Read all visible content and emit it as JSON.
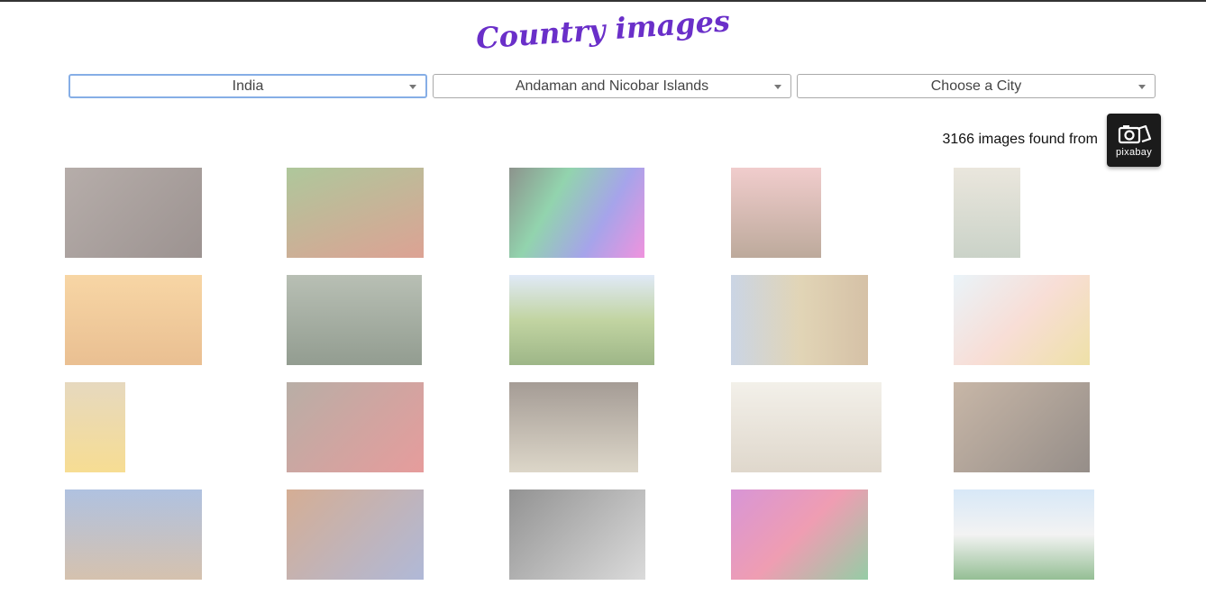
{
  "header": {
    "title": "Country images"
  },
  "filters": {
    "country": "India",
    "region": "Andaman and Nicobar Islands",
    "city": "Choose a City"
  },
  "results": {
    "count_text": "3166 images found from",
    "source_label": "pixabay"
  },
  "gallery": [
    {
      "name": "henna-hands",
      "bg": "linear-gradient(135deg,#7a6a64,#4b3a36)"
    },
    {
      "name": "tea-picker-woman",
      "bg": "linear-gradient(160deg,#6c9a4a,#c0563c)"
    },
    {
      "name": "color-powder-cones",
      "bg": "linear-gradient(120deg,#2f3b2f,#39b06b,#5d59d9,#e33bc2)"
    },
    {
      "name": "old-man-turban",
      "bg": "linear-gradient(180deg,#e5a3a3,#86644a)"
    },
    {
      "name": "taj-mahal-reflection",
      "bg": "linear-gradient(180deg,#d9d2c1,#9fae9b)"
    },
    {
      "name": "river-sunset-boats",
      "bg": "linear-gradient(180deg,#f1b45b,#d88b38)"
    },
    {
      "name": "elephant-forest",
      "bg": "linear-gradient(180deg,#7e8b77,#3a4c36)"
    },
    {
      "name": "green-hills",
      "bg": "linear-gradient(180deg,#c7d8f1,#8fb155,#4e7b26)"
    },
    {
      "name": "weathered-wall",
      "bg": "linear-gradient(90deg,#9fb2cf,#c9b27a,#b38e5e)"
    },
    {
      "name": "girl-painted-hands",
      "bg": "linear-gradient(135deg,#d8eaf4,#f2c2b4,#e0c85f)"
    },
    {
      "name": "woman-yellow-sari",
      "bg": "linear-gradient(180deg,#d2b98a,#f0c13a)"
    },
    {
      "name": "two-children",
      "bg": "linear-gradient(135deg,#7e6c5d,#d24b4b)"
    },
    {
      "name": "dancer-archway",
      "bg": "linear-gradient(180deg,#5b4b3f,#c0b59c)"
    },
    {
      "name": "misty-taj-mahal",
      "bg": "linear-gradient(180deg,#e9e4d8,#c5b7a2)"
    },
    {
      "name": "elder-woman-portrait",
      "bg": "linear-gradient(135deg,#9a7b5f,#3f3128)"
    },
    {
      "name": "man-blue-wall",
      "bg": "linear-gradient(180deg,#6f8fc7,#b38f6c)"
    },
    {
      "name": "boy-reading-book",
      "bg": "linear-gradient(135deg,#b26b3d,#6f7fb7)"
    },
    {
      "name": "woman-veiled-bw",
      "bg": "linear-gradient(135deg,#3a3a3a,#bdbdbd)"
    },
    {
      "name": "holi-festival",
      "bg": "linear-gradient(135deg,#b83fb5,#e24d73,#3ea35c)"
    },
    {
      "name": "taj-mahal-garden",
      "bg": "linear-gradient(180deg,#b7d5f1,#e9e9e9,#3d8a3d)"
    }
  ]
}
